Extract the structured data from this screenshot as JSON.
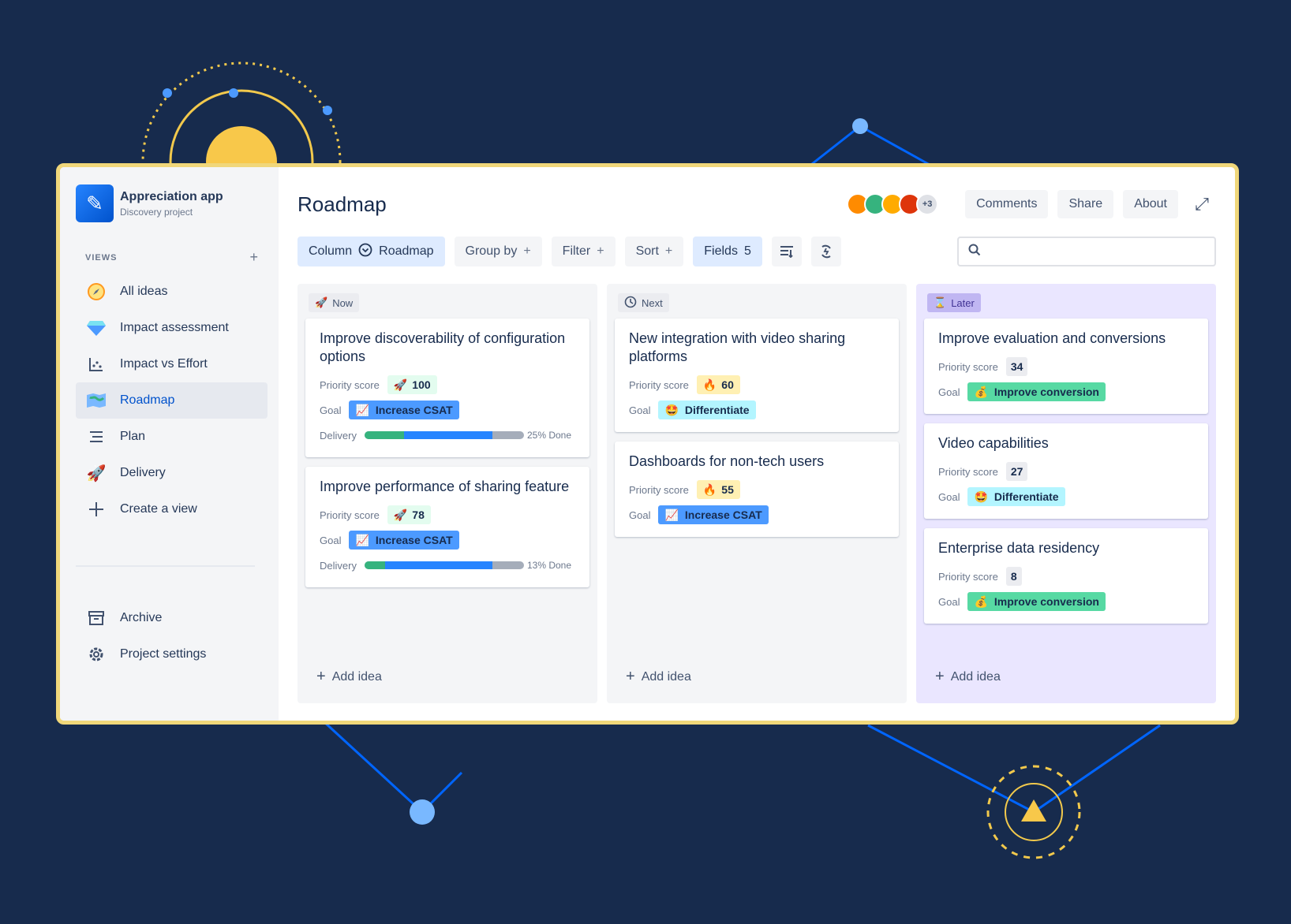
{
  "colors": {
    "background": "#172b4d",
    "frame": "#f0d77a",
    "accent": "#0052cc"
  },
  "sidebar": {
    "app_title": "Appreciation app",
    "app_subtitle": "Discovery project",
    "views_label": "VIEWS",
    "items": [
      {
        "label": "All ideas",
        "icon": "compass-icon"
      },
      {
        "label": "Impact assessment",
        "icon": "diamond-icon"
      },
      {
        "label": "Impact vs Effort",
        "icon": "chart-icon"
      },
      {
        "label": "Roadmap",
        "icon": "map-icon",
        "active": true
      },
      {
        "label": "Plan",
        "icon": "list-icon"
      },
      {
        "label": "Delivery",
        "icon": "rocket-icon"
      },
      {
        "label": "Create a view",
        "icon": "plus-icon"
      }
    ],
    "bottom": [
      {
        "label": "Archive",
        "icon": "archive-icon"
      },
      {
        "label": "Project settings",
        "icon": "gear-icon"
      }
    ]
  },
  "header": {
    "title": "Roadmap",
    "avatars_more": "+3",
    "comments": "Comments",
    "share": "Share",
    "about": "About"
  },
  "toolbar": {
    "column_label": "Column",
    "column_value": "Roadmap",
    "group_by": "Group by",
    "filter": "Filter",
    "sort": "Sort",
    "fields": "Fields",
    "fields_count": "5",
    "search_placeholder": ""
  },
  "labels": {
    "priority": "Priority score",
    "goal": "Goal",
    "delivery": "Delivery",
    "add_idea": "Add idea"
  },
  "columns": [
    {
      "name": "Now",
      "cards": [
        {
          "title": "Improve discoverability of configuration options",
          "score": "100",
          "score_style": "green",
          "goal": "Increase CSAT",
          "goal_style": "blue",
          "delivery_done": 0.25,
          "delivery_progress": 0.55,
          "delivery_text": "25% Done"
        },
        {
          "title": "Improve performance of sharing feature",
          "score": "78",
          "score_style": "green",
          "goal": "Increase CSAT",
          "goal_style": "blue",
          "delivery_done": 0.13,
          "delivery_progress": 0.67,
          "delivery_text": "13% Done"
        }
      ]
    },
    {
      "name": "Next",
      "cards": [
        {
          "title": "New integration with video sharing platforms",
          "score": "60",
          "score_style": "yellow",
          "goal": "Differentiate",
          "goal_style": "teal"
        },
        {
          "title": "Dashboards for non-tech users",
          "score": "55",
          "score_style": "yellow",
          "goal": "Increase CSAT",
          "goal_style": "blue"
        }
      ]
    },
    {
      "name": "Later",
      "cards": [
        {
          "title": "Improve evaluation and conversions",
          "score": "34",
          "score_style": "grey",
          "goal": "Improve conversion",
          "goal_style": "green"
        },
        {
          "title": "Video capabilities",
          "score": "27",
          "score_style": "grey",
          "goal": "Differentiate",
          "goal_style": "teal"
        },
        {
          "title": "Enterprise data residency",
          "score": "8",
          "score_style": "grey",
          "goal": "Improve conversion",
          "goal_style": "green"
        }
      ]
    }
  ]
}
